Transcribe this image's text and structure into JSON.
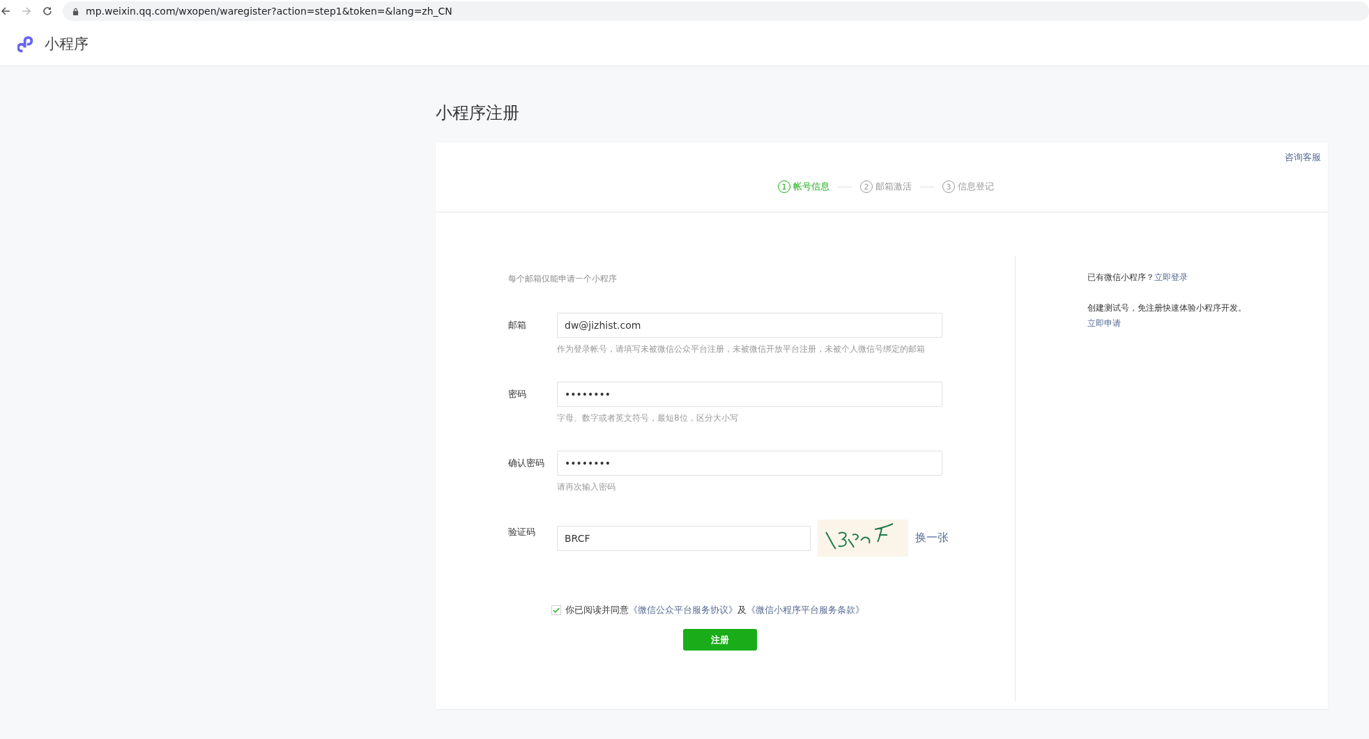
{
  "browser": {
    "url": "mp.weixin.qq.com/wxopen/waregister?action=step1&token=&lang=zh_CN",
    "forward_disabled": true
  },
  "header": {
    "product": "小程序"
  },
  "page_title": "小程序注册",
  "consult_link": "咨询客服",
  "steps": [
    {
      "number": "1",
      "label": "帐号信息",
      "selected": true
    },
    {
      "number": "2",
      "label": "邮箱激活",
      "selected": false
    },
    {
      "number": "3",
      "label": "信息登记",
      "selected": false
    }
  ],
  "form": {
    "notice": "每个邮箱仅能申请一个小程序",
    "fields": [
      {
        "kind": "text",
        "label": "邮箱",
        "value": "dw@jizhist.com",
        "hint": "作为登录帐号，请填写未被微信公众平台注册，未被微信开放平台注册，未被个人微信号绑定的邮箱"
      },
      {
        "kind": "text",
        "label": "密码",
        "value": "••••••••",
        "hint": "字母、数字或者英文符号，最短8位，区分大小写"
      },
      {
        "kind": "text",
        "label": "确认密码",
        "value": "••••••••",
        "hint": "请再次输入密码"
      },
      {
        "kind": "captcha",
        "label": "验证码",
        "value": "BRCF",
        "refresh_link": "换一张"
      }
    ],
    "agreement": {
      "checked": true,
      "text_before": "你已阅读并同意",
      "link_1": "《微信公众平台服务协议》",
      "text_middle": "及",
      "link_2": "《微信小程序平台服务条款》"
    },
    "submit": "注册"
  },
  "side": {
    "login_text": "已有微信小程序？",
    "login_link": "立即登录",
    "test_text": "创建测试号，免注册快速体验小程序开发。",
    "test_link": "立即申请"
  }
}
